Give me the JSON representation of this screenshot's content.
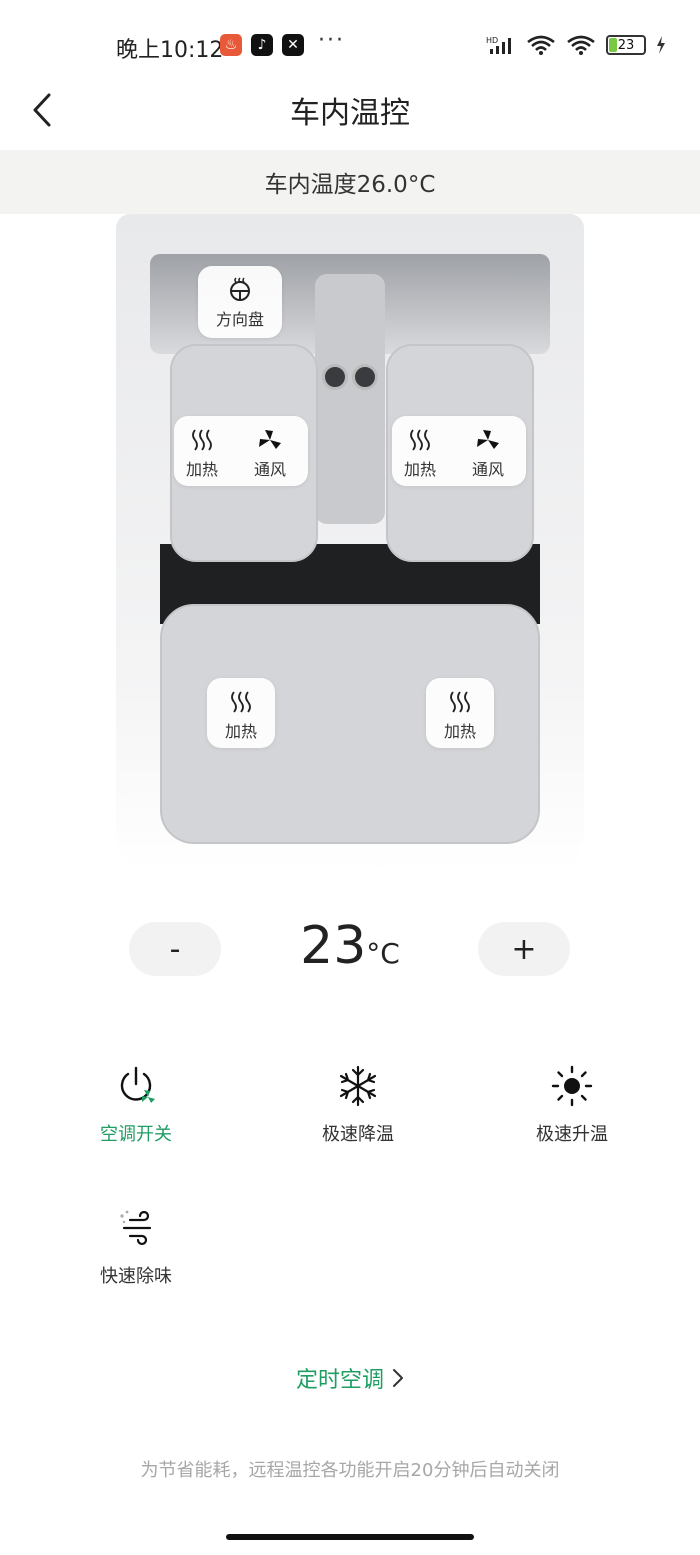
{
  "status_bar": {
    "time": "晚上10:12",
    "more": "···",
    "battery_level": "23",
    "signal": "HD"
  },
  "header": {
    "title": "车内温控"
  },
  "cabin": {
    "temperature_text": "车内温度26.0°C"
  },
  "car_controls": {
    "steering_wheel": "方向盘",
    "front_left": {
      "heat": "加热",
      "vent": "通风"
    },
    "front_right": {
      "heat": "加热",
      "vent": "通风"
    },
    "rear_left": {
      "heat": "加热"
    },
    "rear_right": {
      "heat": "加热"
    }
  },
  "temperature": {
    "minus": "-",
    "value": "23",
    "unit": "°C",
    "plus": "+"
  },
  "functions": [
    {
      "label": "空调开关",
      "icon": "power-fan-icon",
      "active": true
    },
    {
      "label": "极速降温",
      "icon": "snowflake-icon",
      "active": false
    },
    {
      "label": "极速升温",
      "icon": "sun-icon",
      "active": false
    },
    {
      "label": "快速除味",
      "icon": "wind-icon",
      "active": false
    }
  ],
  "timer_link": "定时空调",
  "footer_note": "为节省能耗，远程温控各功能开启20分钟后自动关闭",
  "colors": {
    "accent": "#1f9d63",
    "strip_bg": "#f3f4f2",
    "note": "#a7a7a7"
  }
}
